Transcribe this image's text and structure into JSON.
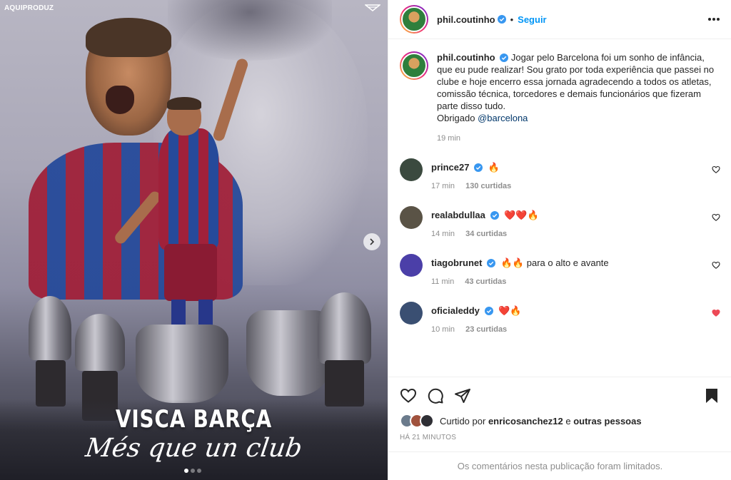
{
  "media": {
    "watermark": "AQUIPRODUZ",
    "headline": "VISCA BARÇA",
    "subline": "Més que un club",
    "slide_count": 3,
    "active_slide": 1
  },
  "header": {
    "username": "phil.coutinho",
    "follow_label": "Seguir"
  },
  "caption": {
    "username": "phil.coutinho",
    "text": "Jogar pelo Barcelona foi um sonho de infância, que eu pude realizar! Sou grato por toda experiência que passei no clube e hoje encerro essa jornada agradecendo a todos os atletas, comissão técnica, torcedores e demais funcionários que fizeram parte disso tudo.",
    "thanks": "Obrigado",
    "mention": "@barcelona",
    "time": "19 min"
  },
  "comments": [
    {
      "username": "prince27",
      "text": "🔥",
      "time": "17 min",
      "likes": "130 curtidas",
      "liked": false,
      "avatar_color": "#3b4a3f"
    },
    {
      "username": "realabdullaa",
      "text": "❤️❤️🔥",
      "time": "14 min",
      "likes": "34 curtidas",
      "liked": false,
      "avatar_color": "#5a5346"
    },
    {
      "username": "tiagobrunet",
      "text": "🔥🔥 para o alto e avante",
      "time": "11 min",
      "likes": "43 curtidas",
      "liked": false,
      "avatar_color": "#4b3fa8"
    },
    {
      "username": "oficialeddy",
      "text": "❤️🔥",
      "time": "10 min",
      "likes": "23 curtidas",
      "liked": true,
      "avatar_color": "#3a4f72"
    }
  ],
  "likes": {
    "prefix": "Curtido por",
    "user": "enricosanchez12",
    "joiner": "e",
    "others": "outras pessoas"
  },
  "posted": "HÁ 21 MINUTOS",
  "limited_notice": "Os comentários nesta publicação foram limitados.",
  "colors": {
    "accent": "#0095f6",
    "liked": "#ed4956",
    "muted": "#8e8e8e"
  }
}
